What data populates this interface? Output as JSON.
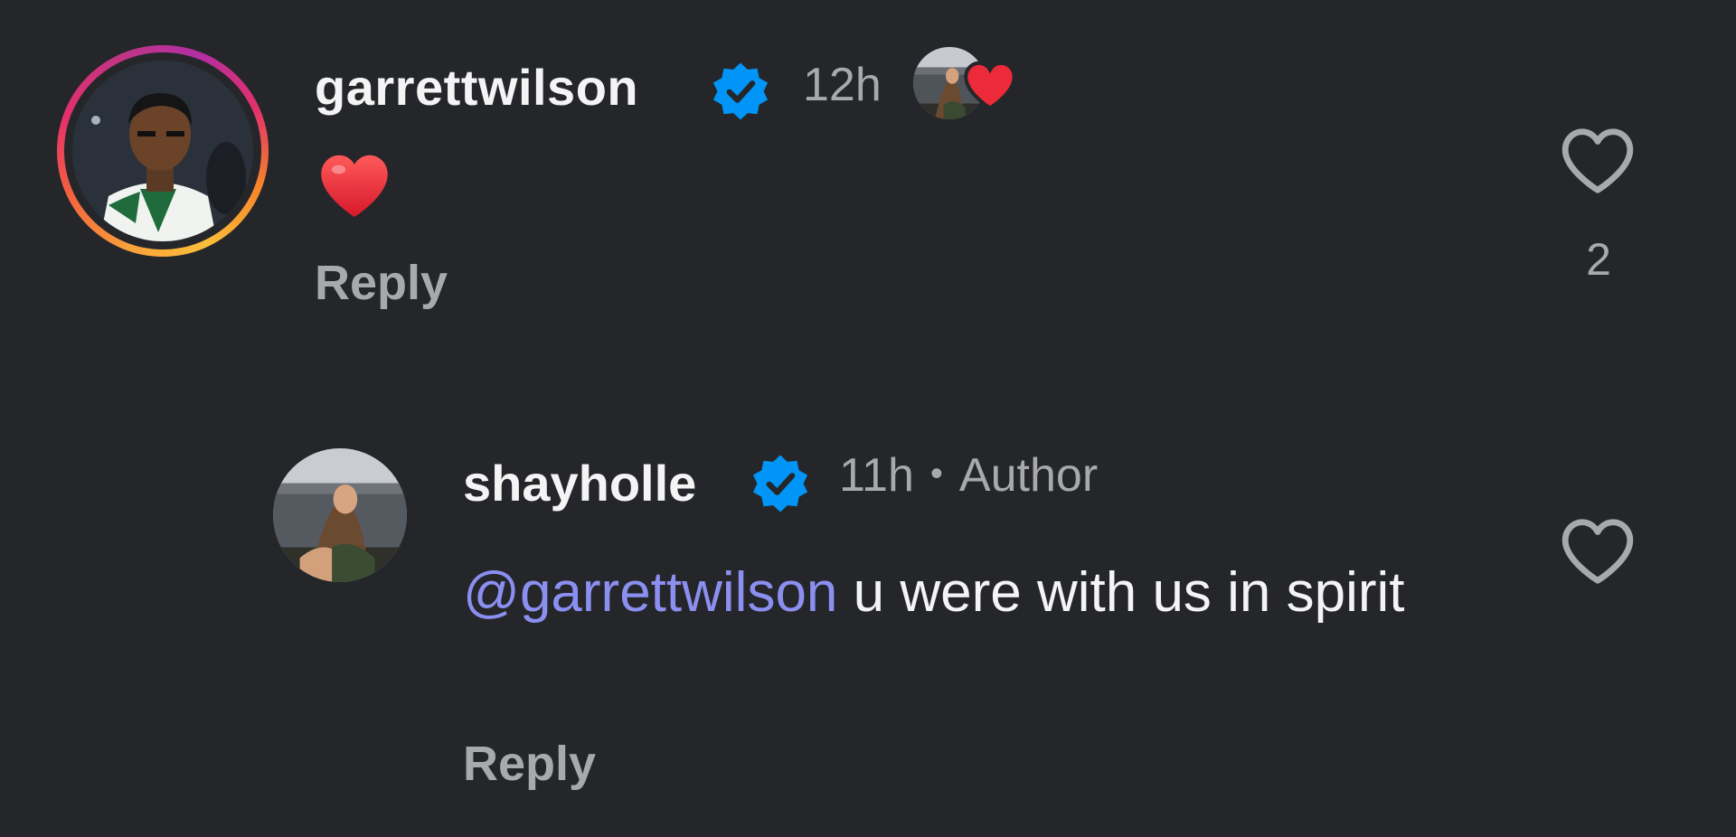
{
  "comments": [
    {
      "username": "garrettwilson",
      "verified": true,
      "time": "12h",
      "body_emoji": "❤️",
      "reply_label": "Reply",
      "like_count": "2",
      "liked_by_author": true
    },
    {
      "username": "shayholle",
      "verified": true,
      "time": "11h",
      "separator": "•",
      "role_badge": "Author",
      "mention": "@garrettwilson",
      "text": " u were with us in spirit",
      "reply_label": "Reply"
    }
  ],
  "colors": {
    "background": "#25262a",
    "text_primary": "#f4f4f5",
    "text_secondary": "#a8a9ad",
    "mention": "#8b8ff0",
    "verified_blue": "#0095f6",
    "heart_red": "#ed2a3a"
  },
  "icons": {
    "verified": "verified-check-icon",
    "like": "heart-outline-icon",
    "liked_by_author": "red-heart-icon"
  }
}
